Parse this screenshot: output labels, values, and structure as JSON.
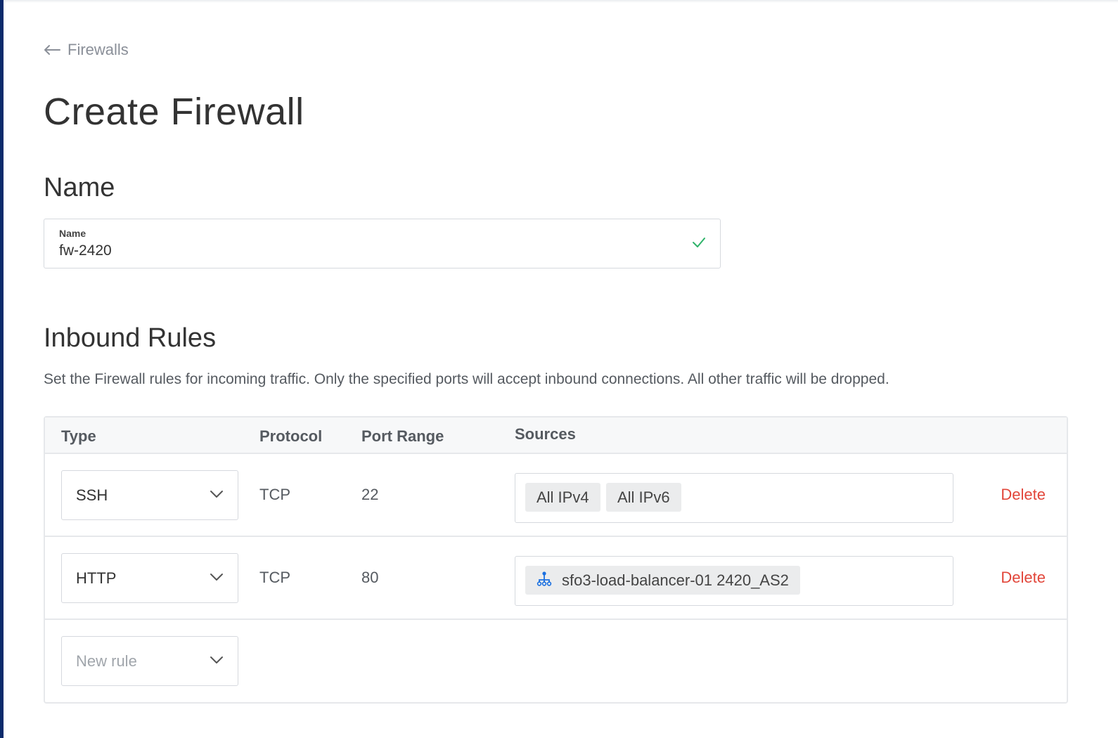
{
  "breadcrumb": {
    "label": "Firewalls"
  },
  "page_title": "Create Firewall",
  "name_section": {
    "title": "Name",
    "field_label": "Name",
    "field_value": "fw-2420"
  },
  "inbound": {
    "title": "Inbound Rules",
    "description": "Set the Firewall rules for incoming traffic. Only the specified ports will accept inbound connections. All other traffic will be dropped.",
    "columns": {
      "type": "Type",
      "protocol": "Protocol",
      "port_range": "Port Range",
      "sources": "Sources"
    },
    "rules": [
      {
        "type": "SSH",
        "protocol": "TCP",
        "port_range": "22",
        "sources": [
          "All IPv4",
          "All IPv6"
        ],
        "delete_label": "Delete"
      },
      {
        "type": "HTTP",
        "protocol": "TCP",
        "port_range": "80",
        "sources": [
          "sfo3-load-balancer-01 2420_AS2"
        ],
        "delete_label": "Delete"
      }
    ],
    "new_rule_placeholder": "New rule"
  },
  "icons": {
    "back": "arrow-left-icon",
    "valid": "check-icon",
    "dropdown": "chevron-down-icon",
    "load_balancer": "load-balancer-icon"
  },
  "colors": {
    "accent_delete": "#e2463a",
    "valid_check": "#2fb36a",
    "load_balancer_icon": "#1a6fe0",
    "sidebar": "#0b2a6b"
  }
}
